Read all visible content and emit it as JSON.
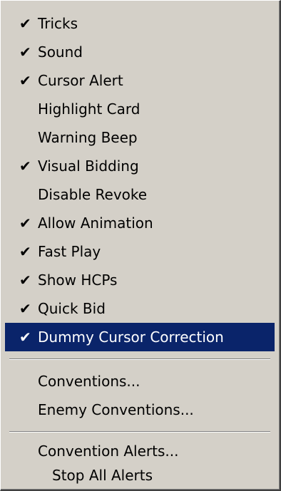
{
  "menu": {
    "items": [
      {
        "label": "Tricks",
        "checked": true,
        "check_glyph": "✔"
      },
      {
        "label": "Sound",
        "checked": true,
        "check_glyph": "✔"
      },
      {
        "label": "Cursor Alert",
        "checked": true,
        "check_glyph": "✔"
      },
      {
        "label": "Highlight Card",
        "checked": false,
        "check_glyph": ""
      },
      {
        "label": "Warning Beep",
        "checked": false,
        "check_glyph": ""
      },
      {
        "label": "Visual Bidding",
        "checked": true,
        "check_glyph": "✔"
      },
      {
        "label": "Disable Revoke",
        "checked": false,
        "check_glyph": ""
      },
      {
        "label": "Allow Animation",
        "checked": true,
        "check_glyph": "✔"
      },
      {
        "label": "Fast Play",
        "checked": true,
        "check_glyph": "✔"
      },
      {
        "label": "Show HCPs",
        "checked": true,
        "check_glyph": "✔"
      },
      {
        "label": "Quick Bid",
        "checked": true,
        "check_glyph": "✔"
      },
      {
        "label": "Dummy Cursor Correction",
        "checked": true,
        "check_glyph": "✔",
        "highlighted": true
      },
      {
        "label": "Conventions..."
      },
      {
        "label": "Enemy Conventions..."
      },
      {
        "label": "Convention Alerts..."
      },
      {
        "label": "Stop All Alerts"
      }
    ]
  },
  "colors": {
    "menu_background": "#d4d0c8",
    "highlight_background": "#0a246a",
    "highlight_text": "#ffffff",
    "text": "#000000"
  },
  "icons": {
    "check": "checkmark-icon"
  }
}
